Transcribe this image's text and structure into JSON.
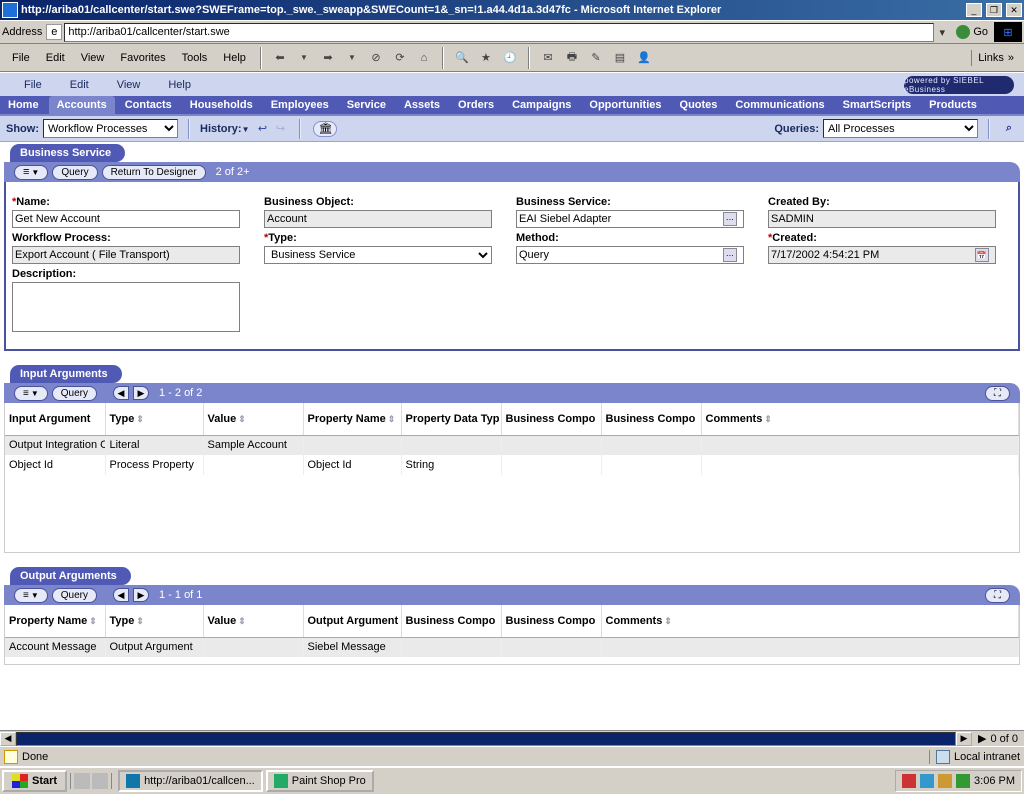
{
  "window": {
    "title": "http://ariba01/callcenter/start.swe?SWEFrame=top._swe._sweapp&SWECount=1&_sn=!1.a44.4d1a.3d47fc - Microsoft Internet Explorer",
    "address_label": "Address",
    "url": "http://ariba01/callcenter/start.swe",
    "go_label": "Go",
    "links_label": "Links",
    "menu": [
      "File",
      "Edit",
      "View",
      "Favorites",
      "Tools",
      "Help"
    ]
  },
  "siebel": {
    "menu": [
      "File",
      "Edit",
      "View",
      "Help"
    ],
    "brand": "powered by SIEBEL eBusiness",
    "tabs": [
      "Home",
      "Accounts",
      "Contacts",
      "Households",
      "Employees",
      "Service",
      "Assets",
      "Orders",
      "Campaigns",
      "Opportunities",
      "Quotes",
      "Communications",
      "SmartScripts",
      "Products"
    ],
    "show_label": "Show:",
    "show_value": "Workflow Processes",
    "history_label": "History:",
    "queries_label": "Queries:",
    "queries_value": "All Processes"
  },
  "business_service": {
    "title": "Business Service",
    "menu_btn": "≡",
    "query_btn": "Query",
    "return_btn": "Return To Designer",
    "counter": "2 of 2+",
    "fields": {
      "name_lbl": "Name:",
      "name_val": "Get New Account",
      "bobj_lbl": "Business Object:",
      "bobj_val": "Account",
      "bsvc_lbl": "Business Service:",
      "bsvc_val": "EAI Siebel Adapter",
      "createdby_lbl": "Created By:",
      "createdby_val": "SADMIN",
      "wfp_lbl": "Workflow Process:",
      "wfp_val": "Export Account ( File Transport)",
      "type_lbl": "Type:",
      "type_val": "Business Service",
      "method_lbl": "Method:",
      "method_val": "Query",
      "created_lbl": "Created:",
      "created_val": "7/17/2002 4:54:21 PM",
      "desc_lbl": "Description:",
      "desc_val": ""
    }
  },
  "input_args": {
    "title": "Input Arguments",
    "query_btn": "Query",
    "counter": "1 - 2 of 2",
    "headers": [
      "Input Argument",
      "Type",
      "Value",
      "Property Name",
      "Property Data Typ",
      "Business Compo",
      "Business Compo",
      "Comments"
    ],
    "rows": [
      [
        "Output Integration O",
        "Literal",
        "Sample Account",
        "",
        "",
        "",
        "",
        ""
      ],
      [
        "Object Id",
        "Process Property",
        "",
        "Object Id",
        "String",
        "",
        "",
        ""
      ]
    ]
  },
  "output_args": {
    "title": "Output Arguments",
    "query_btn": "Query",
    "counter": "1 - 1 of 1",
    "headers": [
      "Property Name",
      "Type",
      "Value",
      "Output Argument",
      "Business Compo",
      "Business Compo",
      "Comments"
    ],
    "rows": [
      [
        "Account Message",
        "Output Argument",
        "",
        "Siebel Message",
        "",
        "",
        ""
      ]
    ]
  },
  "hscroll": {
    "info": "0 of 0"
  },
  "status": {
    "done": "Done",
    "zone": "Local intranet"
  },
  "taskbar": {
    "start": "Start",
    "tasks": [
      "http://ariba01/callcen...",
      "Paint Shop Pro"
    ],
    "clock": "3:06 PM"
  }
}
